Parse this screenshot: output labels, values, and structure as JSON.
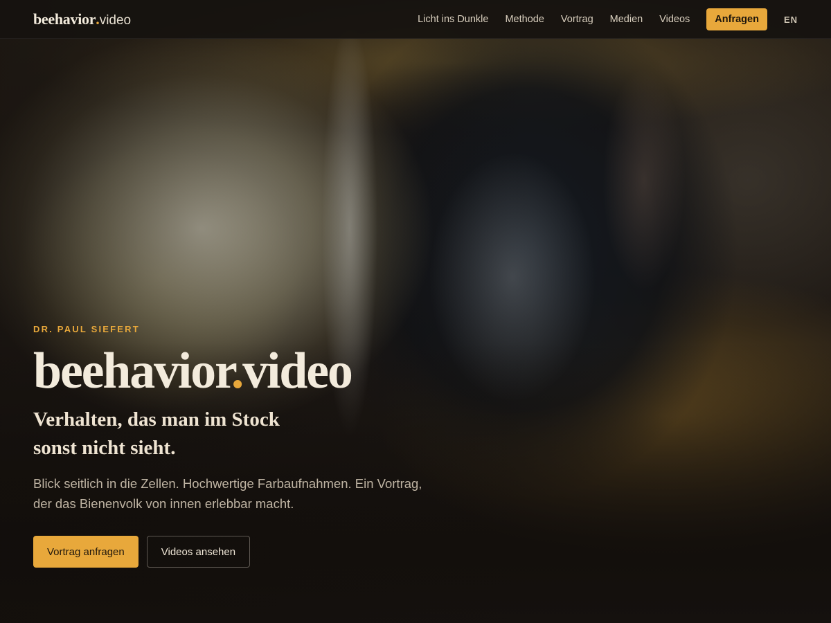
{
  "brand": {
    "name_main": "beehavior",
    "name_dot": ".",
    "name_tld": "video"
  },
  "nav": {
    "links": [
      "Licht ins Dunkle",
      "Methode",
      "Vortrag",
      "Medien",
      "Videos"
    ],
    "cta_label": "Anfragen",
    "language_label": "EN"
  },
  "hero": {
    "eyebrow": "DR. PAUL SIEFERT",
    "title_main": "beehavior",
    "title_dot": ".",
    "title_tld": "video",
    "subtitle": "Verhalten, das man im Stock sonst nicht sieht.",
    "lead": "Blick seitlich in die Zellen. Hochwertige Farbaufnahmen. Ein Vortrag, der das Bienenvolk von innen erlebbar macht.",
    "primary_button": "Vortrag anfragen",
    "secondary_button": "Videos ansehen"
  },
  "colors": {
    "accent": "#e8a83b",
    "background": "#15110e",
    "text": "#f3ebdc",
    "muted_text": "#bfb4a3"
  }
}
